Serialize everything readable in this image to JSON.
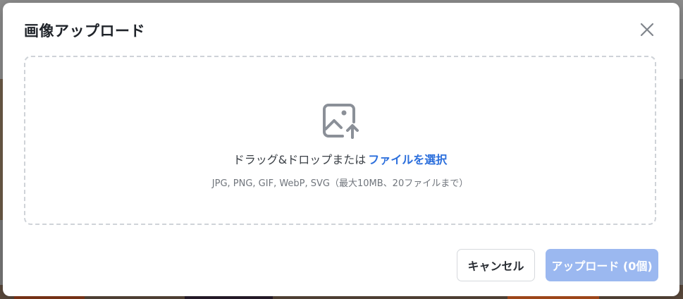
{
  "modal": {
    "title": "画像アップロード",
    "close_icon": "close-icon"
  },
  "dropzone": {
    "icon": "image-upload-icon",
    "drop_text": "ドラッグ&ドロップまたは",
    "select_link": "ファイルを選択",
    "hint": "JPG, PNG, GIF, WebP, SVG（最大10MB、20ファイルまで）"
  },
  "footer": {
    "cancel_label": "キャンセル",
    "upload_label": "アップロード (0個)"
  },
  "colors": {
    "accent": "#2c6fdc",
    "upload_button_disabled": "#9bb8f0",
    "dropzone_border": "#cfd3d8",
    "overlay": "#7a7a7a"
  }
}
